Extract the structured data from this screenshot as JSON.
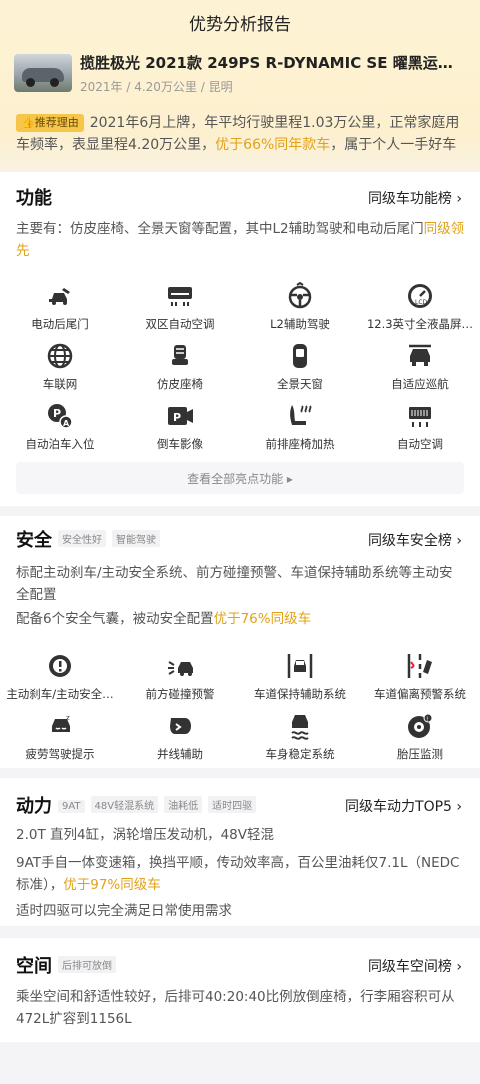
{
  "header": {
    "title": "优势分析报告"
  },
  "car": {
    "title": "揽胜极光 2021款 249PS R-DYNAMIC SE 曜黑运…",
    "subtitle": "2021年 / 4.20万公里 / 昆明"
  },
  "reason": {
    "badge": "推荐理由",
    "text1": "2021年6月上牌，年平均行驶里程1.03万公里，正常家庭用车频率，表显里程4.20万公里，",
    "highlight": "优于66%同年款车",
    "text2": "，属于个人一手好车"
  },
  "features": {
    "title": "功能",
    "link": "同级车功能榜 ›",
    "text1": "主要有：仿皮座椅、全景天窗等配置，其中L2辅助驾驶和电动后尾门",
    "highlight": "同级领先",
    "items": [
      {
        "label": "电动后尾门",
        "icon": "tailgate-icon"
      },
      {
        "label": "双区自动空调",
        "icon": "dual-ac-icon"
      },
      {
        "label": "L2辅助驾驶",
        "icon": "steering-wheel-icon"
      },
      {
        "label": "12.3英寸全液晶屏…",
        "icon": "gauge-icon"
      },
      {
        "label": "车联网",
        "icon": "globe-icon"
      },
      {
        "label": "仿皮座椅",
        "icon": "seat-icon"
      },
      {
        "label": "全景天窗",
        "icon": "sunroof-icon"
      },
      {
        "label": "自适应巡航",
        "icon": "cruise-icon"
      },
      {
        "label": "自动泊车入位",
        "icon": "auto-park-icon"
      },
      {
        "label": "倒车影像",
        "icon": "rear-camera-icon"
      },
      {
        "label": "前排座椅加热",
        "icon": "seat-heat-icon"
      },
      {
        "label": "自动空调",
        "icon": "auto-ac-icon"
      }
    ],
    "more": "查看全部亮点功能 ▸"
  },
  "safety": {
    "title": "安全",
    "tags": [
      "安全性好",
      "智能驾驶"
    ],
    "link": "同级车安全榜 ›",
    "text1": "标配主动刹车/主动安全系统、前方碰撞预警、车道保持辅助系统等主动安全配置",
    "text2a": "配备6个安全气囊，被动安全配置",
    "highlight": "优于76%同级车",
    "items": [
      {
        "label": "主动刹车/主动安全…",
        "icon": "brake-icon"
      },
      {
        "label": "前方碰撞预警",
        "icon": "collision-icon"
      },
      {
        "label": "车道保持辅助系统",
        "icon": "lane-keep-icon"
      },
      {
        "label": "车道偏离预警系统",
        "icon": "lane-depart-icon"
      },
      {
        "label": "疲劳驾驶提示",
        "icon": "fatigue-icon"
      },
      {
        "label": "并线辅助",
        "icon": "mirror-icon"
      },
      {
        "label": "车身稳定系统",
        "icon": "stability-icon"
      },
      {
        "label": "胎压监测",
        "icon": "tire-icon"
      }
    ]
  },
  "power": {
    "title": "动力",
    "tags": [
      "9AT",
      "48V轻混系统",
      "油耗低",
      "适时四驱"
    ],
    "link": "同级车动力TOP5 ›",
    "text1": "2.0T 直列4缸，涡轮增压发动机，48V轻混",
    "text2a": "9AT手自一体变速箱，换挡平顺，传动效率高，百公里油耗仅7.1L（NEDC标准），",
    "highlight": "优于97%同级车",
    "text3": "适时四驱可以完全满足日常使用需求"
  },
  "space": {
    "title": "空间",
    "tags": [
      "后排可放倒"
    ],
    "link": "同级车空间榜 ›",
    "text1": "乘坐空间和舒适性较好，后排可40:20:40比例放倒座椅，行李厢容积可从472L扩容到1156L"
  }
}
